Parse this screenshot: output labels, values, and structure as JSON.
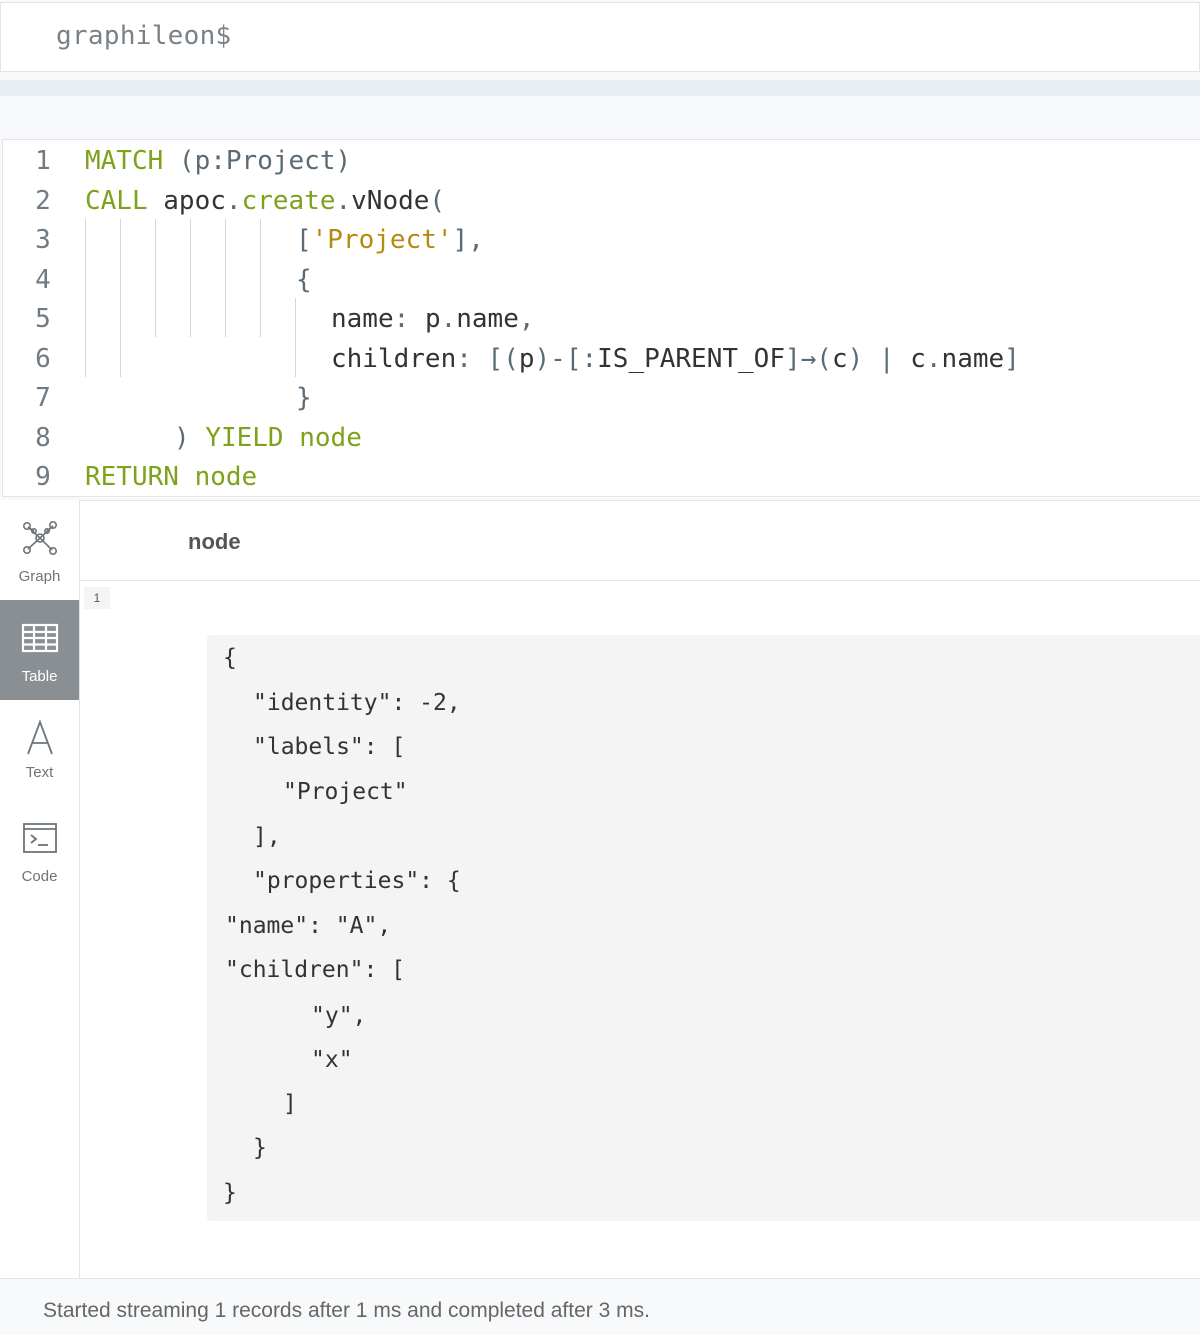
{
  "command_bar": {
    "prompt": "graphileon$"
  },
  "editor": {
    "line_numbers": [
      "1",
      "2",
      "3",
      "4",
      "5",
      "6",
      "7",
      "8",
      "9"
    ],
    "lines": [
      {
        "parts": [
          {
            "t": "MATCH",
            "c": "kw"
          },
          {
            "t": " (p:Project)",
            "c": "punc"
          }
        ]
      },
      {
        "parts": [
          {
            "t": "CALL",
            "c": "kw"
          },
          {
            "t": " apoc",
            "c": ""
          },
          {
            "t": ".",
            "c": "punc"
          },
          {
            "t": "create",
            "c": "fn"
          },
          {
            "t": ".",
            "c": "punc"
          },
          {
            "t": "vNode",
            "c": ""
          },
          {
            "t": "(",
            "c": "punc"
          }
        ]
      },
      {
        "parts": [
          {
            "t": "[",
            "c": "punc"
          },
          {
            "t": "'Project'",
            "c": "str"
          },
          {
            "t": "],",
            "c": "punc"
          }
        ]
      },
      {
        "parts": [
          {
            "t": "{",
            "c": "punc"
          }
        ]
      },
      {
        "parts": [
          {
            "t": "name",
            "c": ""
          },
          {
            "t": ": ",
            "c": "punc"
          },
          {
            "t": "p",
            "c": ""
          },
          {
            "t": ".",
            "c": "punc"
          },
          {
            "t": "name",
            "c": ""
          },
          {
            "t": ",",
            "c": "punc"
          }
        ]
      },
      {
        "parts": [
          {
            "t": "children",
            "c": ""
          },
          {
            "t": ": [(",
            "c": "punc"
          },
          {
            "t": "p",
            "c": ""
          },
          {
            "t": ")-[:",
            "c": "punc"
          },
          {
            "t": "IS_PARENT_OF",
            "c": ""
          },
          {
            "t": "]→(",
            "c": "punc"
          },
          {
            "t": "c",
            "c": ""
          },
          {
            "t": ") | ",
            "c": "punc"
          },
          {
            "t": "c",
            "c": ""
          },
          {
            "t": ".",
            "c": "punc"
          },
          {
            "t": "name",
            "c": ""
          },
          {
            "t": "]",
            "c": "punc"
          }
        ]
      },
      {
        "parts": [
          {
            "t": "}",
            "c": "punc"
          }
        ]
      },
      {
        "parts": [
          {
            "t": ") ",
            "c": "punc"
          },
          {
            "t": "YIELD node",
            "c": "kw"
          }
        ]
      },
      {
        "parts": [
          {
            "t": "RETURN node",
            "c": "kw"
          }
        ]
      }
    ]
  },
  "sidebar": {
    "items": [
      {
        "label": "Graph",
        "icon": "graph-icon",
        "active": false
      },
      {
        "label": "Table",
        "icon": "table-icon",
        "active": true
      },
      {
        "label": "Text",
        "icon": "text-icon",
        "active": false
      },
      {
        "label": "Code",
        "icon": "code-icon",
        "active": false
      }
    ]
  },
  "table": {
    "column_header": "node",
    "row_index": "1",
    "json_lines": [
      "{",
      "\"identity\": -2,",
      "\"labels\": [",
      "\"Project\"",
      "],",
      "\"properties\": {",
      "\"name\": \"A\",",
      "\"children\": [",
      "\"y\",",
      "\"x\"",
      "]",
      "}",
      "}"
    ]
  },
  "status": {
    "text": "Started streaming 1 records after 1 ms and completed after 3 ms."
  }
}
